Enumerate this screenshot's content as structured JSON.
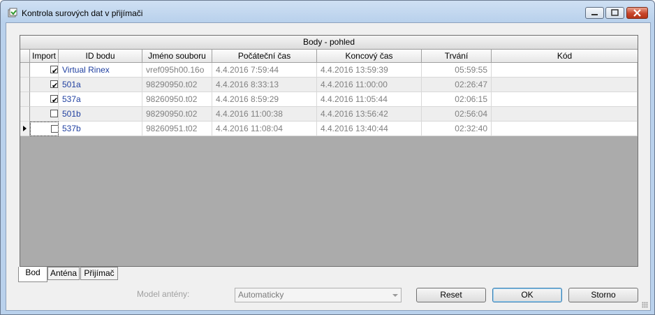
{
  "window": {
    "title": "Kontrola surových dat v přijímači"
  },
  "grid": {
    "group_title": "Body - pohled",
    "columns": [
      "Import",
      "ID bodu",
      "Jméno souboru",
      "Počáteční čas",
      "Koncový čas",
      "Trvání",
      "Kód"
    ],
    "rows": [
      {
        "import": "✔",
        "id": "Virtual Rinex",
        "file": "vref095h00.16o",
        "start": "4.4.2016 7:59:44",
        "end": "4.4.2016 13:59:39",
        "duration": "05:59:55",
        "code": ""
      },
      {
        "import": "✔",
        "id": "501a",
        "file": "98290950.t02",
        "start": "4.4.2016 8:33:13",
        "end": "4.4.2016 11:00:00",
        "duration": "02:26:47",
        "code": ""
      },
      {
        "import": "✔",
        "id": "537a",
        "file": "98260950.t02",
        "start": "4.4.2016 8:59:29",
        "end": "4.4.2016 11:05:44",
        "duration": "02:06:15",
        "code": ""
      },
      {
        "import": "",
        "id": "501b",
        "file": "98290950.t02",
        "start": "4.4.2016 11:00:38",
        "end": "4.4.2016 13:56:42",
        "duration": "02:56:04",
        "code": ""
      },
      {
        "import": "",
        "id": "537b",
        "file": "98260951.t02",
        "start": "4.4.2016 11:08:04",
        "end": "4.4.2016 13:40:44",
        "duration": "02:32:40",
        "code": ""
      }
    ]
  },
  "tabs": [
    "Bod",
    "Anténa",
    "Přijímač"
  ],
  "footer": {
    "model_label": "Model antény:",
    "model_value": "Automaticky",
    "reset": "Reset",
    "ok": "OK",
    "cancel": "Storno"
  }
}
